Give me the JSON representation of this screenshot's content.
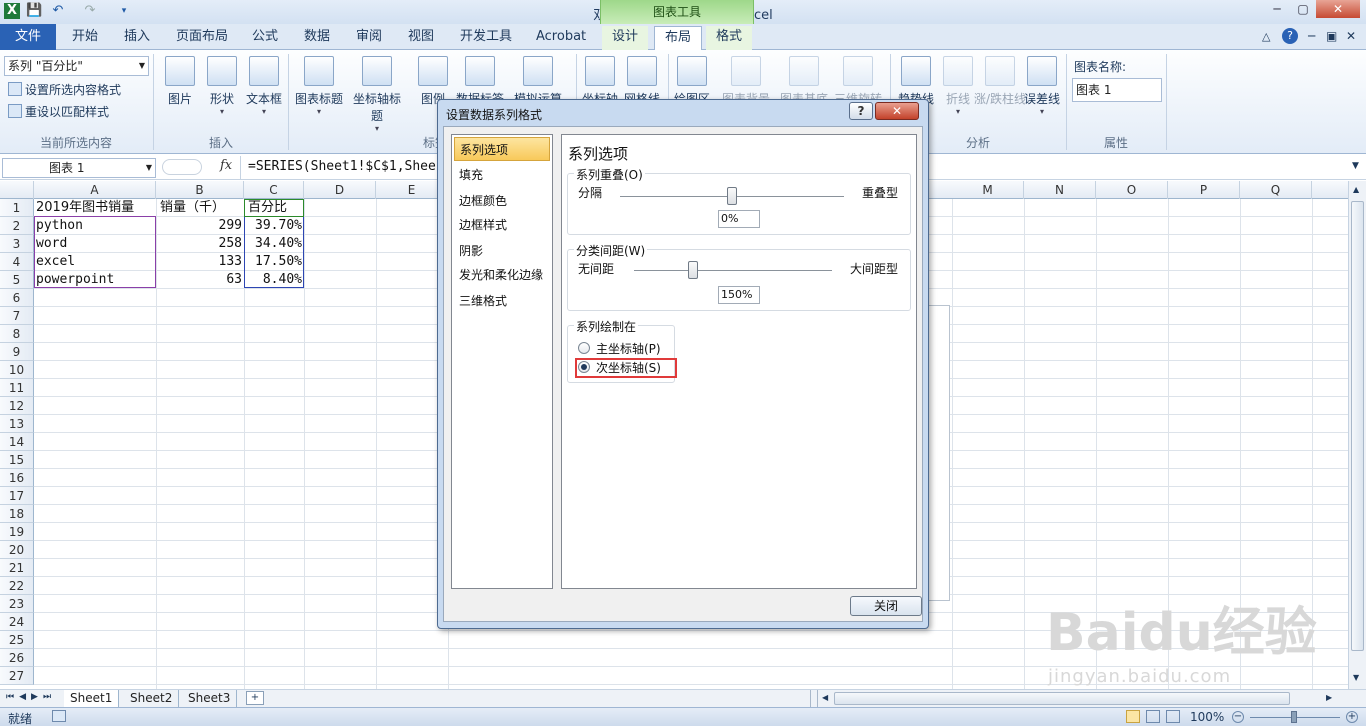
{
  "window": {
    "title": "双坐标.xlsx - Microsoft Excel",
    "context_group": "图表工具",
    "controls": [
      "─",
      "▢",
      "✕"
    ]
  },
  "tabs": [
    "文件",
    "开始",
    "插入",
    "页面布局",
    "公式",
    "数据",
    "审阅",
    "视图",
    "开发工具",
    "Acrobat",
    "设计",
    "布局",
    "格式"
  ],
  "active_tab": "布局",
  "ribbon": {
    "selection_combo": "系列 \"百分比\"",
    "format_selection": "设置所选内容格式",
    "reset_style": "重设以匹配样式",
    "group_current": "当前所选内容",
    "group_insert": "插入",
    "group_labels": "标签",
    "group_analysis": "分析",
    "group_properties": "属性",
    "insert_buttons": [
      "图片",
      "形状",
      "文本框"
    ],
    "label_buttons": [
      "图表标题",
      "坐标轴标题",
      "图例",
      "数据标签",
      "模拟运算表"
    ],
    "axes_buttons": [
      "坐标轴",
      "网格线"
    ],
    "bg_buttons": [
      "绘图区",
      "图表背景墙",
      "图表基底",
      "三维旋转"
    ],
    "analysis_buttons": [
      "趋势线",
      "折线",
      "涨/跌柱线",
      "误差线"
    ],
    "chart_name_label": "图表名称:",
    "chart_name_value": "图表 1"
  },
  "formula_bar": {
    "name_box": "图表 1",
    "fx": "fx",
    "formula": "=SERIES(Sheet1!$C$1,Shee"
  },
  "sheet": {
    "columns": [
      "A",
      "B",
      "C",
      "D",
      "E",
      "M",
      "N",
      "O",
      "P",
      "Q"
    ],
    "rows": [
      "1",
      "2",
      "3",
      "4",
      "5",
      "6",
      "7",
      "8",
      "9",
      "10",
      "11",
      "12",
      "13",
      "14",
      "15",
      "16",
      "17",
      "18",
      "19",
      "20",
      "21",
      "22",
      "23",
      "24",
      "25",
      "26",
      "27"
    ],
    "cells": {
      "A1": "2019年图书销量",
      "B1": "销量（千）",
      "C1": "百分比",
      "A2": "python",
      "B2": "299",
      "C2": "39.70%",
      "A3": "word",
      "B3": "258",
      "C3": "34.40%",
      "A4": "excel",
      "B4": "133",
      "C4": "17.50%",
      "A5": "powerpoint",
      "B5": "63",
      "C5": "8.40%"
    },
    "sheet_tabs": [
      "Sheet1",
      "Sheet2",
      "Sheet3"
    ]
  },
  "status": {
    "ready": "就绪",
    "zoom": "100%"
  },
  "dialog": {
    "title": "设置数据系列格式",
    "help": "?",
    "close_x": "✕",
    "categories": [
      "系列选项",
      "填充",
      "边框颜色",
      "边框样式",
      "阴影",
      "发光和柔化边缘",
      "三维格式"
    ],
    "selected_category": "系列选项",
    "panel_title": "系列选项",
    "overlap": {
      "legend": "系列重叠(O)",
      "left": "分隔",
      "right": "重叠型",
      "value": "0%",
      "level": 0.5
    },
    "gap": {
      "legend": "分类间距(W)",
      "left": "无间距",
      "right": "大间距型",
      "value": "150%",
      "level": 0.3
    },
    "plot_on": {
      "legend": "系列绘制在",
      "primary": "主坐标轴(P)",
      "secondary": "次坐标轴(S)",
      "selected": "secondary"
    },
    "close_button": "关闭"
  },
  "watermark": {
    "main": "Baidu经验",
    "sub": "jingyan.baidu.com"
  }
}
